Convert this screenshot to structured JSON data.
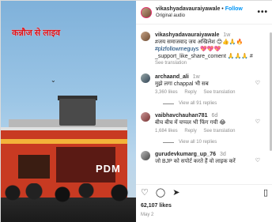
{
  "media": {
    "overlay_text": "कन्नौज से लाइव",
    "badge_text": "PDM",
    "bird_glyph": "⌄"
  },
  "header": {
    "username": "vikashyadavauraiyawale",
    "follow": "Follow",
    "separator": "•",
    "audio": "Original audio",
    "more": "•••"
  },
  "caption": {
    "username": "vikashyadavauraiyawale",
    "time": "1w",
    "line1": "#जय समाजवाद जय अखिलेश 😊👍🙏🔥",
    "line2": "#plzfollowmeguys 💖💖💖",
    "line3": "_support_like_share_coment 🙏🙏🙏 #",
    "see_translation": "See translation"
  },
  "comments": [
    {
      "username": "archaand_ali",
      "time": "1w",
      "text": "मुझे लगा chappal भी सब",
      "likes": "3,360 likes",
      "reply": "Reply",
      "see_translation": "See translation",
      "view_replies": "View all 91 replies"
    },
    {
      "username": "vaibhavchauhan781",
      "time": "6d",
      "text": "बीच बीच में चप्पल भी फिंग गयी 😂",
      "likes": "1,684 likes",
      "reply": "Reply",
      "see_translation": "See translation",
      "view_replies": "View all 10 replies"
    },
    {
      "username": "gurudevkumarg_up_76",
      "time": "3d",
      "text": "जो BJP को सपोर्ट करते हैं वो लाइक करें",
      "likes": "",
      "reply": "",
      "see_translation": "",
      "view_replies": ""
    }
  ],
  "actions": {
    "like_icon": "♡",
    "comment_icon": "◯",
    "share_icon": "➤",
    "save_icon": "▯"
  },
  "likes_count": "62,107 likes",
  "date": "May 2"
}
